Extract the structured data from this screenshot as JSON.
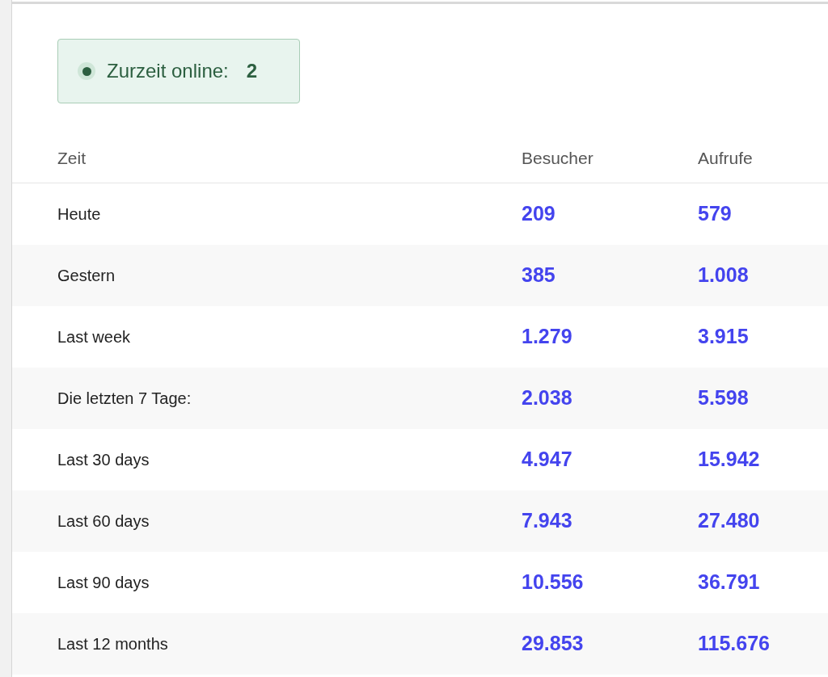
{
  "online": {
    "label": "Zurzeit online:",
    "count": "2"
  },
  "table": {
    "columns": [
      "Zeit",
      "Besucher",
      "Aufrufe"
    ],
    "rows": [
      {
        "period": "Heute",
        "visitors": "209",
        "views": "579"
      },
      {
        "period": "Gestern",
        "visitors": "385",
        "views": "1.008"
      },
      {
        "period": "Last week",
        "visitors": "1.279",
        "views": "3.915"
      },
      {
        "period": "Die letzten 7 Tage:",
        "visitors": "2.038",
        "views": "5.598"
      },
      {
        "period": "Last 30 days",
        "visitors": "4.947",
        "views": "15.942"
      },
      {
        "period": "Last 60 days",
        "visitors": "7.943",
        "views": "27.480"
      },
      {
        "period": "Last 90 days",
        "visitors": "10.556",
        "views": "36.791"
      },
      {
        "period": "Last 12 months",
        "visitors": "29.853",
        "views": "115.676"
      }
    ]
  }
}
